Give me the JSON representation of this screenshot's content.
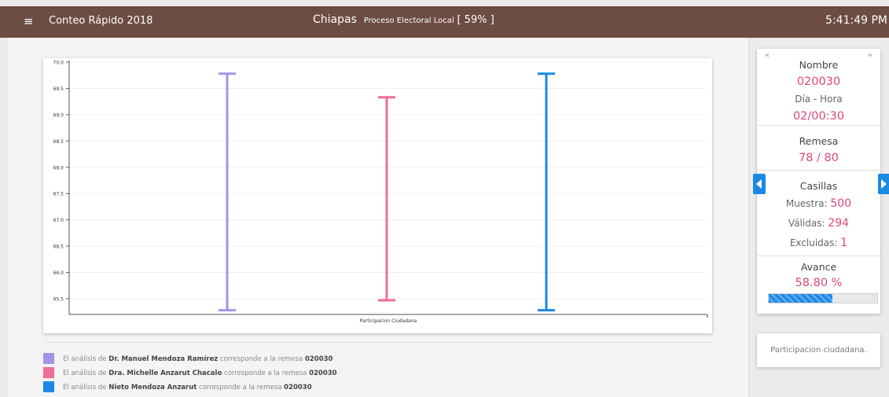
{
  "header": {
    "menu_icon": "hamburger-icon",
    "app_title": "Conteo Rápido 2018",
    "state": "Chiapas",
    "process": "Proceso Electoral Local",
    "percent": "[ 59% ]",
    "clock": "5:41:49 PM"
  },
  "chart_data": {
    "type": "error-bar",
    "xlabel": "Participacion Ciudadana",
    "ylabel": "",
    "ylim": [
      65.2,
      70.0
    ],
    "yticks": [
      "70.0",
      "69.5",
      "69.0",
      "68.5",
      "68.0",
      "67.5",
      "67.0",
      "66.5",
      "66.0",
      "65.5"
    ],
    "series": [
      {
        "name": "Dr. Manuel Mendoza Ramírez",
        "low": 65.28,
        "high": 69.78,
        "color": "#a592e8"
      },
      {
        "name": "Dra. Michelle Anzarut Chacalo",
        "low": 65.47,
        "high": 69.33,
        "color": "#ef6d9a"
      },
      {
        "name": "Nieto Mendoza Anzarut",
        "low": 65.28,
        "high": 69.78,
        "color": "#1e88e5"
      }
    ]
  },
  "legend": [
    {
      "prefix": "El análisis de",
      "name": "Dr. Manuel Mendoza Ramírez",
      "middle": "corresponde a la remesa",
      "code": "020030",
      "color": "#a592e8"
    },
    {
      "prefix": "El análisis de",
      "name": "Dra. Michelle Anzarut Chacalo",
      "middle": "corresponde a la remesa",
      "code": "020030",
      "color": "#ef6d9a"
    },
    {
      "prefix": "El análisis de",
      "name": "Nieto Mendoza Anzarut",
      "middle": "corresponde a la remesa",
      "code": "020030",
      "color": "#1e88e5"
    }
  ],
  "info": {
    "prev_label": "«",
    "next_label": "»",
    "nombre_label": "Nombre",
    "nombre_value": "020030",
    "dia_hora_label": "Día - Hora",
    "dia_hora_value": "02/00:30",
    "remesa_label": "Remesa",
    "remesa_value": "78 / 80",
    "casillas_label": "Casillas",
    "muestra_label": "Muestra:",
    "muestra_value": "500",
    "validas_label": "Válidas:",
    "validas_value": "294",
    "excluidas_label": "Excluidas:",
    "excluidas_value": "1",
    "avance_label": "Avance",
    "avance_value": "58.80 %",
    "avance_fraction": 0.588
  },
  "note": "Participacion ciudadana.",
  "colors": {
    "header_bg": "#6d4c41",
    "accent_pink": "#e0467c",
    "accent_blue": "#1e88e5"
  }
}
